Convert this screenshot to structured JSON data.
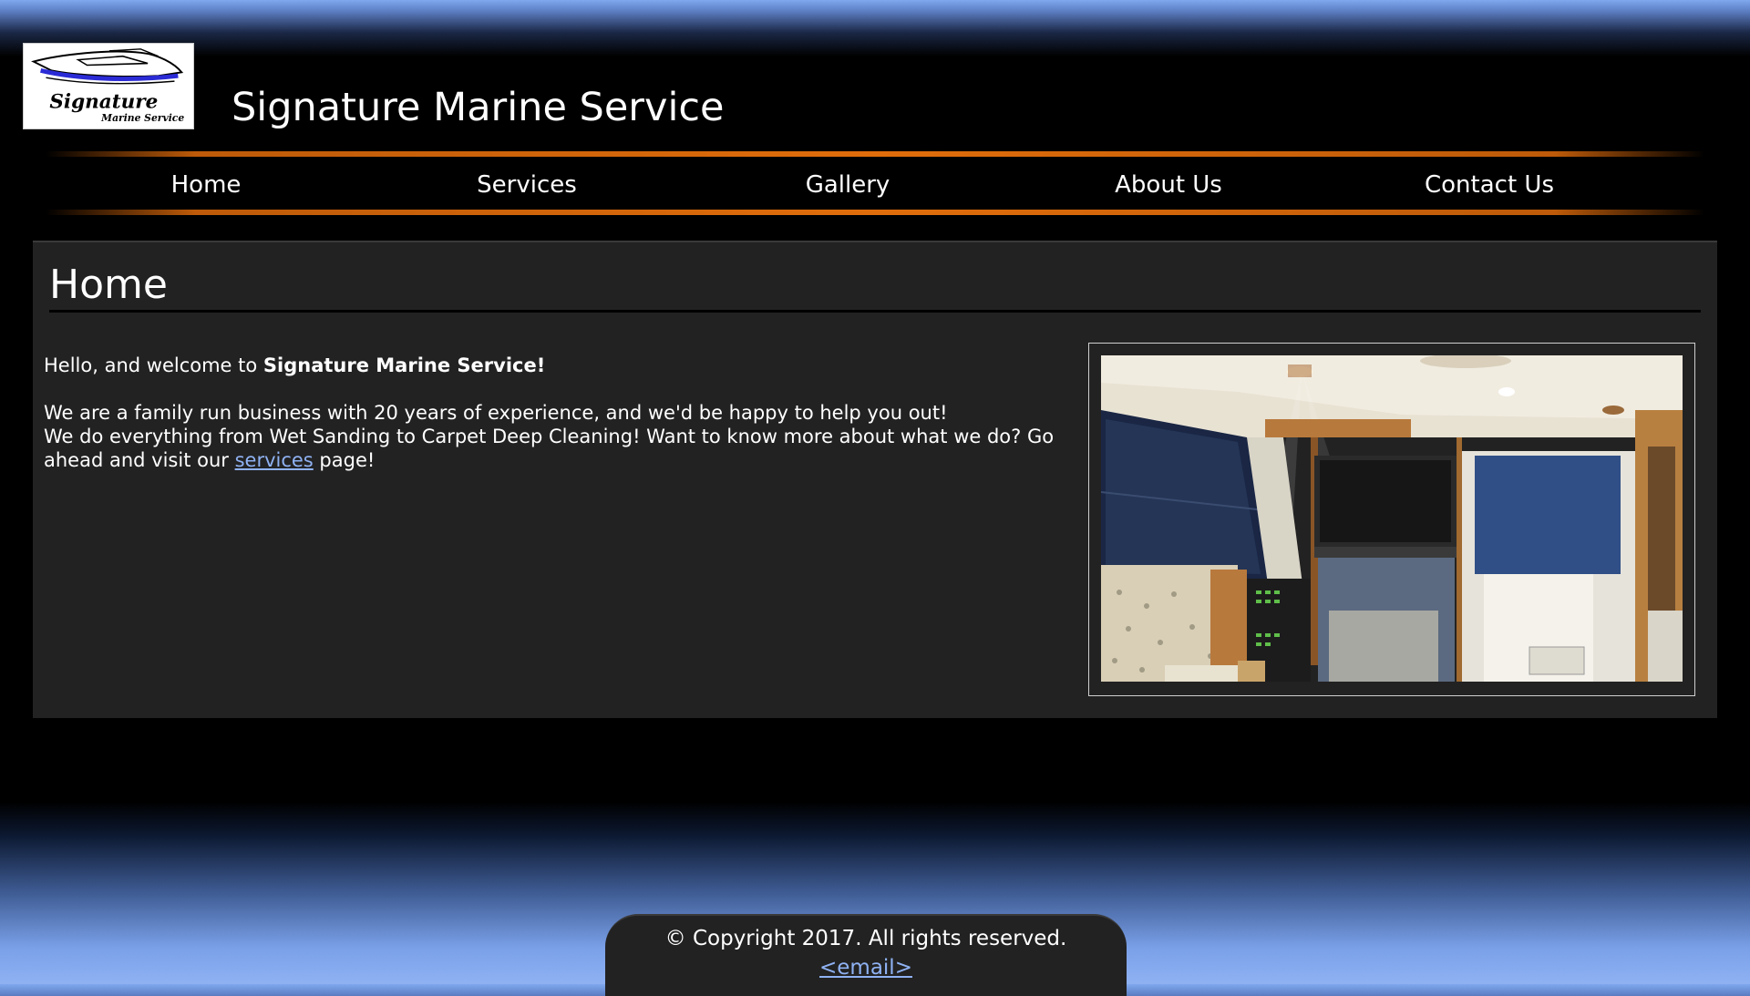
{
  "colors": {
    "accent_orange": "#e06d0b",
    "panel_background": "#222222",
    "link_blue": "#8fb2f3",
    "sky_blue": "#7fa8ee"
  },
  "header": {
    "logo_text": "Signature",
    "logo_subtext": "Marine Service",
    "title": "Signature Marine Service"
  },
  "nav": {
    "items": [
      {
        "label": "Home"
      },
      {
        "label": "Services"
      },
      {
        "label": "Gallery"
      },
      {
        "label": "About Us"
      },
      {
        "label": "Contact Us"
      }
    ]
  },
  "main": {
    "heading": "Home",
    "intro": {
      "greeting_prefix": "Hello, and welcome to ",
      "greeting_bold": "Signature Marine Service!",
      "line1": "We are a family run business with 20 years of experience, and we'd be happy to help you out!",
      "line2_prefix": "We do everything from Wet Sanding to Carpet Deep Cleaning! Want to know more about what we do? Go ahead and visit our ",
      "services_link": "services",
      "line2_suffix": " page!"
    },
    "photo_subject": "boat-cabin-interior-photo"
  },
  "footer": {
    "copyright": "© Copyright 2017. All rights reserved.",
    "email_link": "<email>"
  }
}
